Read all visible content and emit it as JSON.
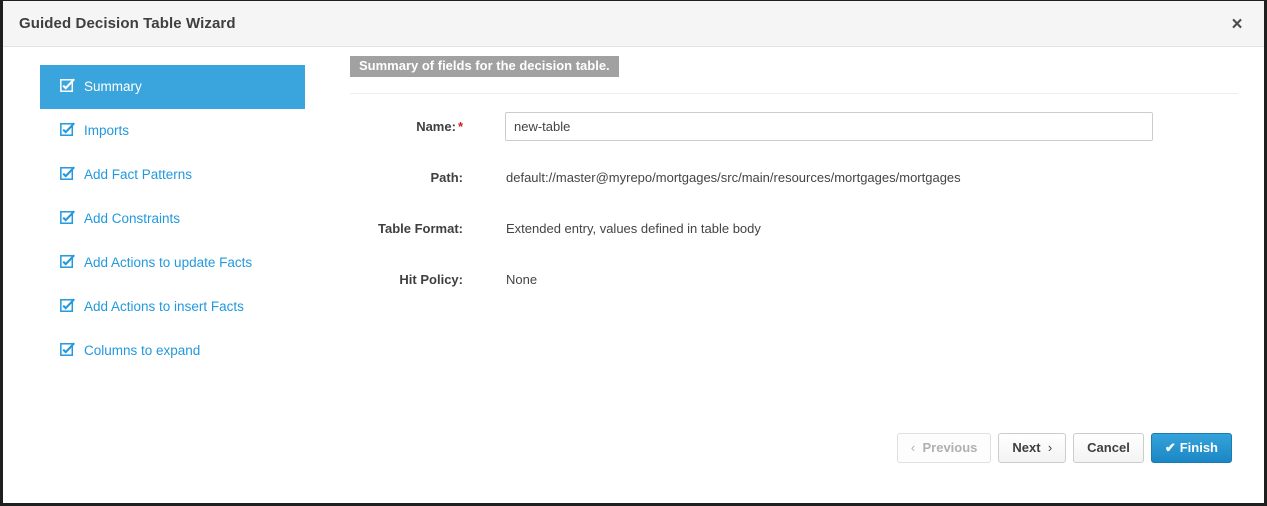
{
  "window": {
    "title": "Guided Decision Table Wizard",
    "close_label": "×",
    "close_icon": "close-icon"
  },
  "sidebar": {
    "items": [
      {
        "label": "Summary",
        "icon": "checkbox-checked-icon",
        "active": true
      },
      {
        "label": "Imports",
        "icon": "checkbox-checked-icon",
        "active": false
      },
      {
        "label": "Add Fact Patterns",
        "icon": "checkbox-checked-icon",
        "active": false
      },
      {
        "label": "Add Constraints",
        "icon": "checkbox-checked-icon",
        "active": false
      },
      {
        "label": "Add Actions to update Facts",
        "icon": "checkbox-checked-icon",
        "active": false
      },
      {
        "label": "Add Actions to insert Facts",
        "icon": "checkbox-checked-icon",
        "active": false
      },
      {
        "label": "Columns to expand",
        "icon": "checkbox-checked-icon",
        "active": false
      }
    ]
  },
  "content": {
    "section_title": "Summary of fields for the decision table.",
    "fields": {
      "name": {
        "label": "Name:",
        "required_marker": "*",
        "value": "new-table",
        "placeholder": ""
      },
      "path": {
        "label": "Path:",
        "value": "default://master@myrepo/mortgages/src/main/resources/mortgages/mortgages"
      },
      "table_format": {
        "label": "Table Format:",
        "value": "Extended entry, values defined in table body"
      },
      "hit_policy": {
        "label": "Hit Policy:",
        "value": "None"
      }
    }
  },
  "footer": {
    "previous_label": "Previous",
    "previous_chevron": "‹",
    "next_label": "Next",
    "next_chevron": "›",
    "cancel_label": "Cancel",
    "finish_label": "Finish",
    "finish_check": "✔"
  },
  "colors": {
    "accent_blue": "#3aa5dc",
    "link_blue": "#2299dd",
    "badge_gray": "#a1a1a1",
    "required_red": "#cc1f1f",
    "primary_button": "#1b86c4"
  }
}
